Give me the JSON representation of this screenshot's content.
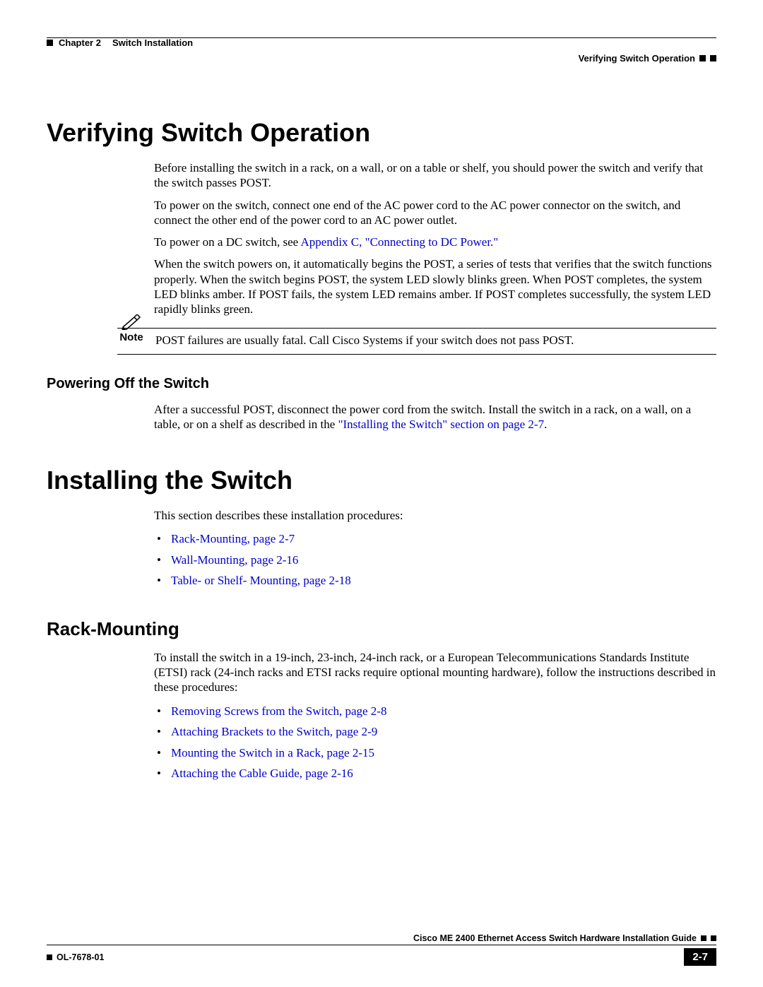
{
  "header": {
    "chapter_label": "Chapter 2",
    "chapter_title": "Switch Installation",
    "section_title": "Verifying Switch Operation"
  },
  "h1_verify": "Verifying Switch Operation",
  "para_intro": "Before installing the switch in a rack, on a wall, or on a table or shelf, you should power the switch and verify that the switch passes POST.",
  "para_power_on": "To power on the switch, connect one end of the AC power cord to the AC power connector on the switch, and connect the other end of the power cord to an AC power outlet.",
  "para_dc_prefix": "To power on a DC switch, see ",
  "link_dc": "Appendix C, \"Connecting to DC Power.\"",
  "para_post": "When the switch powers on, it automatically begins the POST, a series of tests that verifies that the switch functions properly. When the switch begins POST, the system LED slowly blinks green. When POST completes, the system LED blinks amber. If POST fails, the system LED remains amber. If POST completes successfully, the system LED rapidly blinks green.",
  "note_label": "Note",
  "note_text": "POST failures are usually fatal. Call Cisco Systems if your switch does not pass POST.",
  "h3_power_off": "Powering Off the Switch",
  "para_power_off_prefix": "After a successful POST, disconnect the power cord from the switch. Install the switch in a rack, on a wall, on a table, or on a shelf as described in the ",
  "link_install": "\"Installing the Switch\" section on page 2-7",
  "para_power_off_suffix": ".",
  "h1_install": "Installing the Switch",
  "para_install_intro": "This section describes these installation procedures:",
  "install_links": [
    "Rack-Mounting, page 2-7",
    "Wall-Mounting, page 2-16",
    "Table- or Shelf- Mounting, page 2-18"
  ],
  "h2_rack": "Rack-Mounting",
  "para_rack": "To install the switch in a 19-inch, 23-inch, 24-inch rack, or a European Telecommunications Standards Institute (ETSI) rack (24-inch racks and ETSI racks require optional mounting hardware), follow the instructions described in these procedures:",
  "rack_links": [
    "Removing Screws from the Switch, page 2-8",
    "Attaching Brackets to the Switch, page 2-9",
    "Mounting the Switch in a Rack, page 2-15",
    "Attaching the Cable Guide, page 2-16"
  ],
  "footer": {
    "guide_title": "Cisco ME 2400 Ethernet Access Switch Hardware Installation Guide",
    "doc_number": "OL-7678-01",
    "page_number": "2-7"
  }
}
